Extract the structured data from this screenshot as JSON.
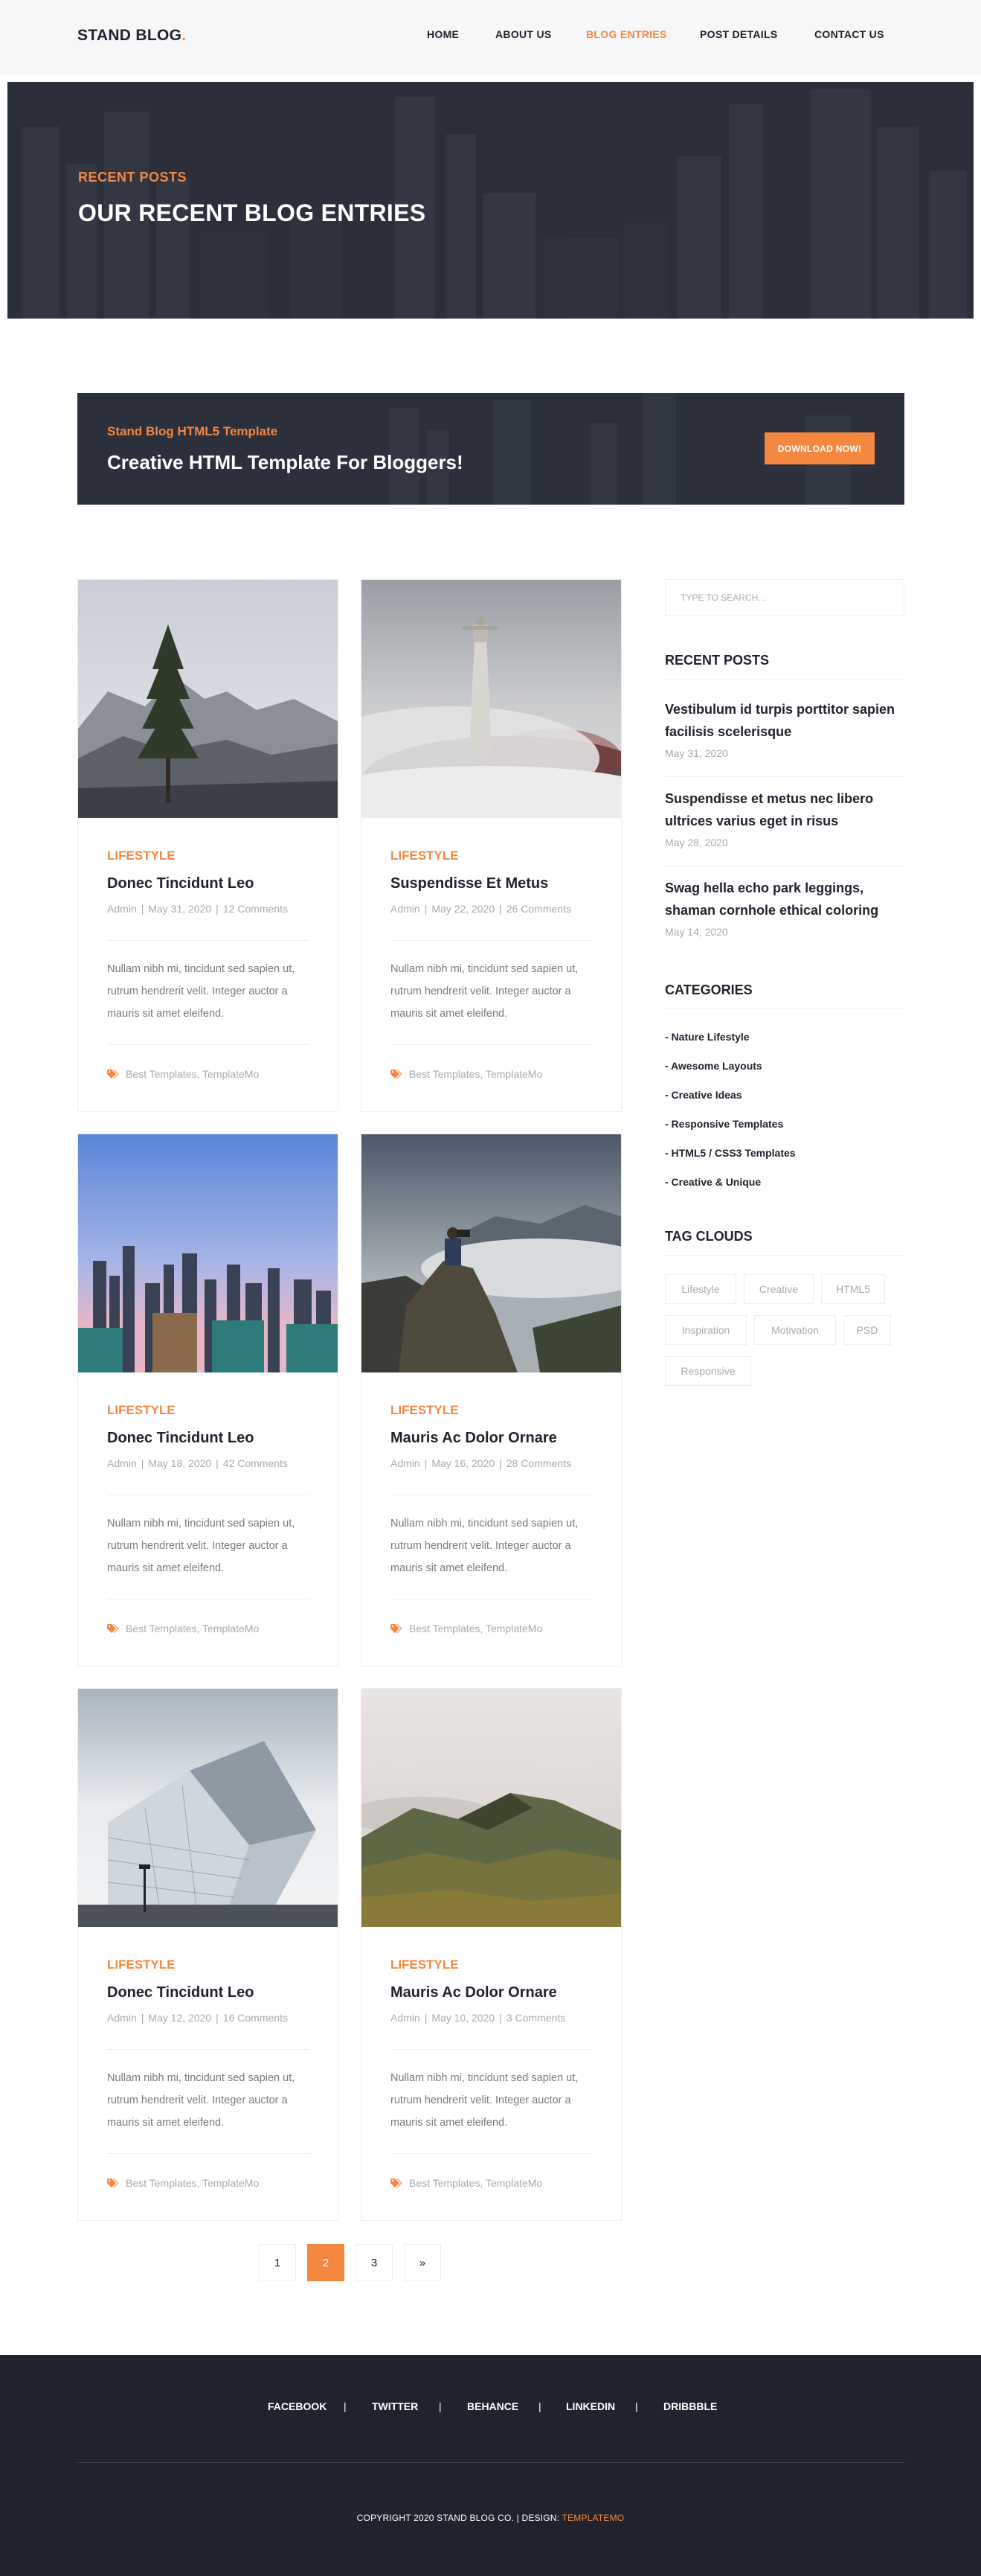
{
  "brand": {
    "name": "STAND BLOG",
    "dot": ".",
    "accent_color": "#f48840",
    "dark_color": "#20232e"
  },
  "nav": [
    {
      "label": "HOME",
      "active": false
    },
    {
      "label": "ABOUT US",
      "active": false
    },
    {
      "label": "BLOG ENTRIES",
      "active": true
    },
    {
      "label": "POST DETAILS",
      "active": false
    },
    {
      "label": "CONTACT US",
      "active": false
    }
  ],
  "hero": {
    "kicker": "RECENT POSTS",
    "title": "OUR RECENT BLOG ENTRIES"
  },
  "cta": {
    "kicker": "Stand Blog HTML5 Template",
    "title": "Creative HTML Template For Bloggers!",
    "button": "DOWNLOAD NOW!"
  },
  "posts": [
    {
      "category": "LIFESTYLE",
      "title": "Donec Tincidunt Leo",
      "author": "Admin",
      "date": "May 31, 2020",
      "comments": "12 Comments",
      "excerpt": "Nullam nibh mi, tincidunt sed sapien ut, rutrum hendrerit velit. Integer auctor a mauris sit amet eleifend.",
      "tags": "Best Templates, TemplateMo",
      "image_icon": "mountain-tree-image"
    },
    {
      "category": "LIFESTYLE",
      "title": "Suspendisse Et Metus",
      "author": "Admin",
      "date": "May 22, 2020",
      "comments": "26 Comments",
      "excerpt": "Nullam nibh mi, tincidunt sed sapien ut, rutrum hendrerit velit. Integer auctor a mauris sit amet eleifend.",
      "tags": "Best Templates, TemplateMo",
      "image_icon": "statue-fog-image"
    },
    {
      "category": "LIFESTYLE",
      "title": "Donec Tincidunt Leo",
      "author": "Admin",
      "date": "May 18, 2020",
      "comments": "42 Comments",
      "excerpt": "Nullam nibh mi, tincidunt sed sapien ut, rutrum hendrerit velit. Integer auctor a mauris sit amet eleifend.",
      "tags": "Best Templates, TemplateMo",
      "image_icon": "city-skyline-image"
    },
    {
      "category": "LIFESTYLE",
      "title": "Mauris Ac Dolor Ornare",
      "author": "Admin",
      "date": "May 16, 2020",
      "comments": "28 Comments",
      "excerpt": "Nullam nibh mi, tincidunt sed sapien ut, rutrum hendrerit velit. Integer auctor a mauris sit amet eleifend.",
      "tags": "Best Templates, TemplateMo",
      "image_icon": "photographer-cliff-image"
    },
    {
      "category": "LIFESTYLE",
      "title": "Donec Tincidunt Leo",
      "author": "Admin",
      "date": "May 12, 2020",
      "comments": "16 Comments",
      "excerpt": "Nullam nibh mi, tincidunt sed sapien ut, rutrum hendrerit velit. Integer auctor a mauris sit amet eleifend.",
      "tags": "Best Templates, TemplateMo",
      "image_icon": "glass-building-image"
    },
    {
      "category": "LIFESTYLE",
      "title": "Mauris Ac Dolor Ornare",
      "author": "Admin",
      "date": "May 10, 2020",
      "comments": "3 Comments",
      "excerpt": "Nullam nibh mi, tincidunt sed sapien ut, rutrum hendrerit velit. Integer auctor a mauris sit amet eleifend.",
      "tags": "Best Templates, TemplateMo",
      "image_icon": "green-hills-image"
    }
  ],
  "pagination": [
    {
      "label": "1",
      "active": false
    },
    {
      "label": "2",
      "active": true
    },
    {
      "label": "3",
      "active": false
    },
    {
      "label": "»",
      "active": false
    }
  ],
  "sidebar": {
    "search_placeholder": "TYPE TO SEARCH...",
    "recent_heading": "RECENT POSTS",
    "recent": [
      {
        "title": "Vestibulum id turpis porttitor sapien facilisis scelerisque",
        "date": "May 31, 2020"
      },
      {
        "title": "Suspendisse et metus nec libero ultrices varius eget in risus",
        "date": "May 28, 2020"
      },
      {
        "title": "Swag hella echo park leggings, shaman cornhole ethical coloring",
        "date": "May 14, 2020"
      }
    ],
    "categories_heading": "CATEGORIES",
    "categories": [
      "- Nature Lifestyle",
      "- Awesome Layouts",
      "- Creative Ideas",
      "- Responsive Templates",
      "- HTML5 / CSS3 Templates",
      "- Creative & Unique"
    ],
    "tags_heading": "TAG CLOUDS",
    "tags": [
      "Lifestyle",
      "Creative",
      "HTML5",
      "Inspiration",
      "Motivation",
      "PSD",
      "Responsive"
    ]
  },
  "footer": {
    "social": [
      "FACEBOOK",
      "TWITTER",
      "BEHANCE",
      "LINKEDIN",
      "DRIBBBLE"
    ],
    "separator": "|",
    "copyright": "COPYRIGHT 2020 STAND BLOG CO. | DESIGN: ",
    "design_link": "TEMPLATEMO"
  }
}
